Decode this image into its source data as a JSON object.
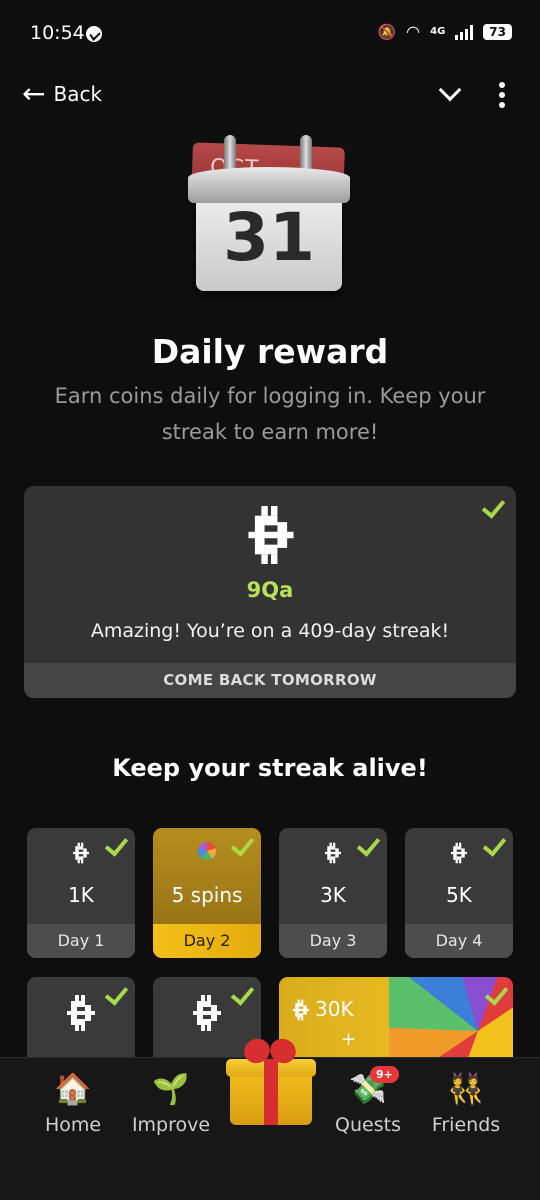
{
  "status_bar": {
    "time": "10:54",
    "network": "4G",
    "battery": "73"
  },
  "nav": {
    "back_label": "Back"
  },
  "calendar": {
    "month": "OCT",
    "day": "31"
  },
  "header": {
    "title": "Daily reward",
    "subtitle": "Earn coins daily for logging in. Keep your streak to earn more!"
  },
  "reward": {
    "amount": "9Qa",
    "message": "Amazing! You’re on a 409-day streak!",
    "button": "COME BACK TOMORROW"
  },
  "streak": {
    "title": "Keep your streak alive!",
    "days": [
      {
        "value": "1K",
        "label": "Day 1"
      },
      {
        "value": "5 spins",
        "label": "Day 2"
      },
      {
        "value": "3K",
        "label": "Day 3"
      },
      {
        "value": "5K",
        "label": "Day 4"
      }
    ],
    "big_reward": {
      "value": "30K",
      "plus": "+"
    }
  },
  "bottom_nav": {
    "items": [
      {
        "label": "Home"
      },
      {
        "label": "Improve"
      },
      {
        "label": "Quests",
        "badge": "9+"
      },
      {
        "label": "Friends"
      }
    ]
  },
  "colors": {
    "accent_green": "#a9d94a",
    "gold": "#f2c01a",
    "card_bg": "#333333"
  }
}
